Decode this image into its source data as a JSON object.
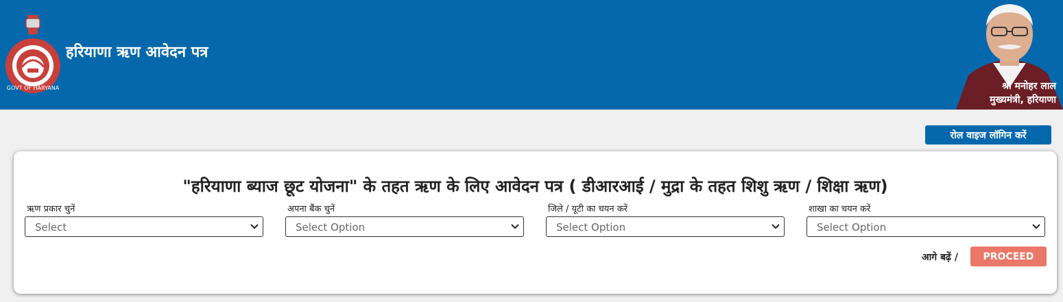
{
  "header": {
    "title": "हरियाणा ऋण आवेदन पत्र",
    "cm_name": "श्री मनोहर लाल",
    "cm_designation": "मुख्यमंत्री, हरियाणा",
    "emblem_text": "GOVT OF HARYANA",
    "emblem_icon": "haryana-emblem-icon",
    "bg_color": "#0668ac"
  },
  "actions": {
    "login_label": "रोल वाइज लॉगिन करें"
  },
  "form": {
    "heading": "\"हरियाणा ब्याज छूट योजना\" के तहत ऋण के लिए आवेदन पत्र ( डीआरआई / मुद्रा के तहत शिशु ऋण / शिक्षा ऋण)",
    "fields": [
      {
        "label": "ऋण प्रकार चुनें",
        "value": "Select"
      },
      {
        "label": "अपना बैंक चुनें",
        "value": "Select Option"
      },
      {
        "label": "जिले / यूटी का चयन करें",
        "value": "Select Option"
      },
      {
        "label": "शाखा का चयन करें",
        "value": "Select Option"
      }
    ],
    "proceed_text": "आगे बढ़ें /",
    "proceed_button": "PROCEED",
    "proceed_color": "#ea7767"
  }
}
